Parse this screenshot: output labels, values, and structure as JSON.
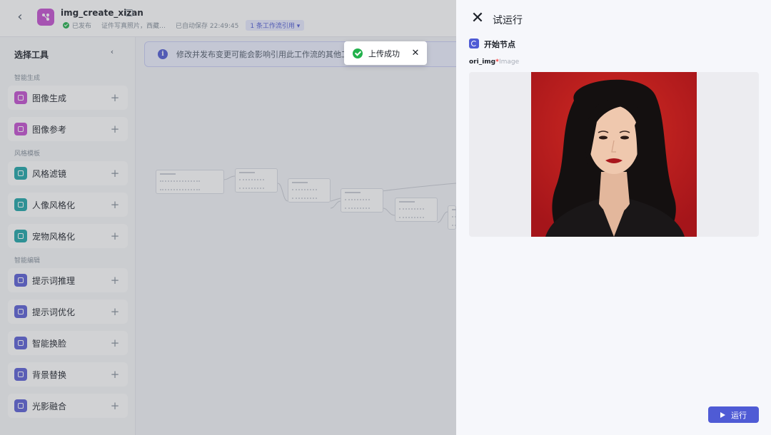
{
  "header": {
    "title": "img_create_xizan",
    "status": "已发布",
    "description": "证件写真照片，西藏…",
    "autosave": "已自动保存 22:49:45",
    "ref_badge": "1 条工作流引用 ▾"
  },
  "sidebar": {
    "title": "选择工具",
    "groups": [
      {
        "label": "智能生成",
        "items": [
          {
            "label": "图像生成",
            "color": "#c44fd0"
          },
          {
            "label": "图像参考",
            "color": "#c44fd0"
          }
        ]
      },
      {
        "label": "风格模板",
        "items": [
          {
            "label": "风格滤镜",
            "color": "#1fa5a8"
          },
          {
            "label": "人像风格化",
            "color": "#1fa5a8"
          },
          {
            "label": "宠物风格化",
            "color": "#1fa5a8"
          }
        ]
      },
      {
        "label": "智能编辑",
        "items": [
          {
            "label": "提示词推理",
            "color": "#5b5fd6"
          },
          {
            "label": "提示词优化",
            "color": "#5b5fd6"
          },
          {
            "label": "智能换脸",
            "color": "#5b5fd6"
          },
          {
            "label": "背景替换",
            "color": "#5b5fd6"
          },
          {
            "label": "光影融合",
            "color": "#5b5fd6"
          }
        ]
      }
    ]
  },
  "canvas": {
    "notice": "修改并发布变更可能会影响引用此工作流的其他工作"
  },
  "toast": {
    "text": "上传成功"
  },
  "panel": {
    "title": "试运行",
    "start_node": "开始节点",
    "field_name": "ori_img",
    "field_required": "*",
    "field_type": "Image",
    "run_label": "运行"
  },
  "colors": {
    "accent": "#4f5bd5",
    "success": "#22b14c",
    "photo_background": "#b81d1b"
  }
}
